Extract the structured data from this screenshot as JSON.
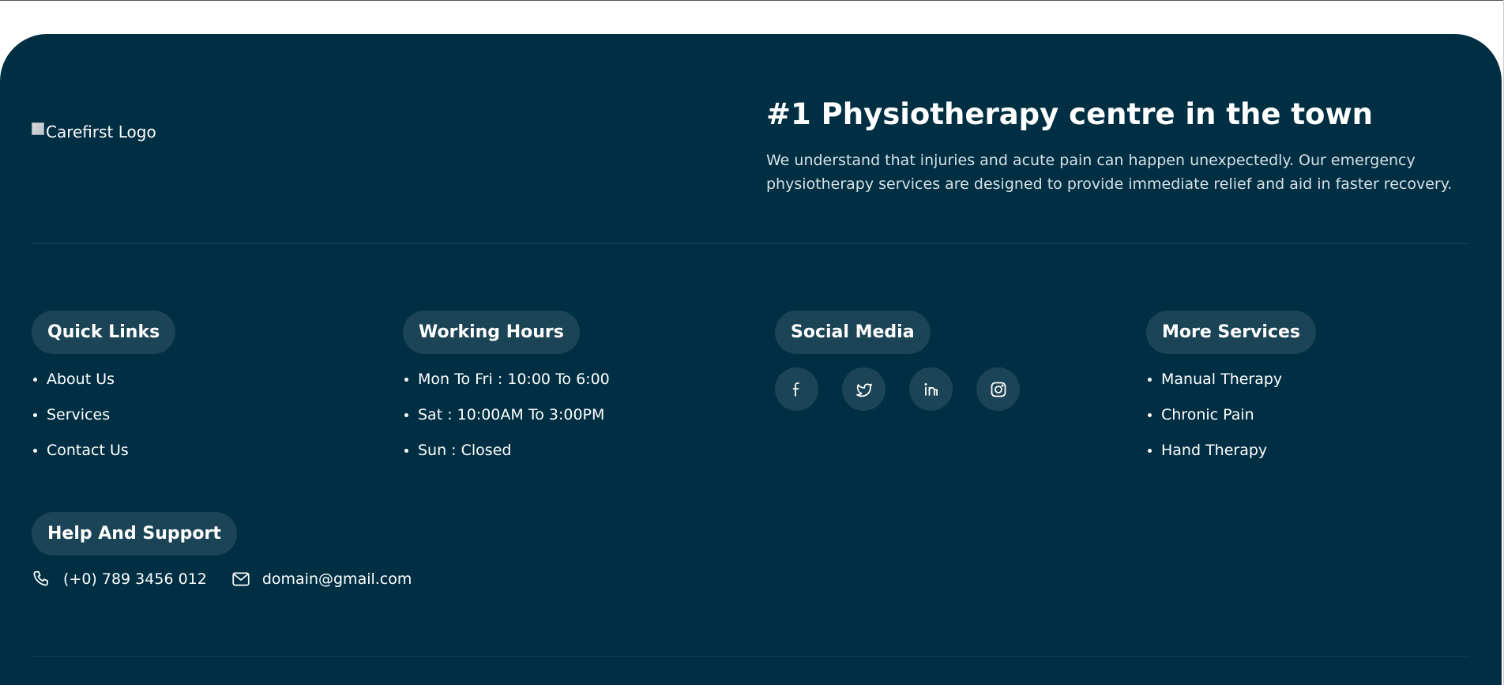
{
  "logo": {
    "alt": "Carefirst Logo"
  },
  "hero": {
    "title": "#1 Physiotherapy centre in the town",
    "description": "We understand that injuries and acute pain can happen unexpectedly. Our emergency physiotherapy services are designed to provide immediate relief and aid in faster recovery."
  },
  "quick_links": {
    "title": "Quick Links",
    "items": [
      {
        "label": "About Us"
      },
      {
        "label": "Services"
      },
      {
        "label": "Contact Us"
      }
    ]
  },
  "working_hours": {
    "title": "Working Hours",
    "items": [
      {
        "label": "Mon To Fri : 10:00 To 6:00"
      },
      {
        "label": "Sat : 10:00AM To 3:00PM"
      },
      {
        "label": "Sun : Closed"
      }
    ]
  },
  "social_media": {
    "title": "Social Media",
    "items": [
      {
        "icon": "facebook-icon"
      },
      {
        "icon": "twitter-icon"
      },
      {
        "icon": "linkedin-icon"
      },
      {
        "icon": "instagram-icon"
      }
    ]
  },
  "more_services": {
    "title": "More Services",
    "items": [
      {
        "label": "Manual Therapy"
      },
      {
        "label": "Chronic Pain"
      },
      {
        "label": "Hand Therapy"
      }
    ]
  },
  "help_support": {
    "title": "Help And Support",
    "phone": "(+0) 789 3456 012",
    "email": "domain@gmail.com"
  },
  "colors": {
    "footer_bg": "#002f43",
    "pill_bg": "#1b4456",
    "text": "#ffffff",
    "muted_text": "#d6e0e5"
  }
}
